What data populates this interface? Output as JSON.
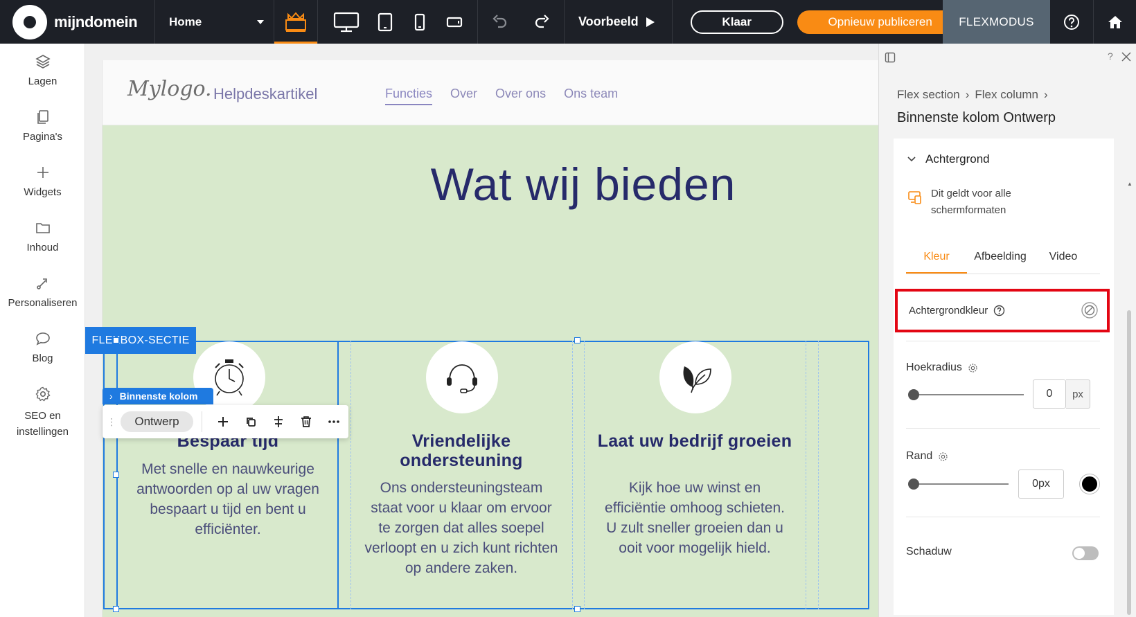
{
  "topbar": {
    "brand": "mijndomein",
    "page_select": "Home",
    "preview": "Voorbeeld",
    "done": "Klaar",
    "publish": "Opnieuw publiceren",
    "flexmode": "FLEXMODUS",
    "accent_color": "#f98b14"
  },
  "sidebar": {
    "items": [
      {
        "label": "Lagen",
        "icon": "layers-icon"
      },
      {
        "label": "Pagina's",
        "icon": "pages-icon"
      },
      {
        "label": "Widgets",
        "icon": "plus-icon"
      },
      {
        "label": "Inhoud",
        "icon": "folder-icon"
      },
      {
        "label": "Personaliseren",
        "icon": "personalize-icon"
      },
      {
        "label": "Blog",
        "icon": "chat-bubble-icon"
      },
      {
        "label": "SEO en instellingen",
        "icon": "gear-icon"
      }
    ]
  },
  "site": {
    "logo": "Mylogo.",
    "title": "Helpdeskartikel",
    "nav": [
      "Functies",
      "Over",
      "Over ons",
      "Ons team"
    ],
    "heading": "Wat wij bieden",
    "flex_tag": "FLEXBOX-SECTIE",
    "inner_tag": "Binnenste kolom",
    "toolbar_pill": "Ontwerp",
    "features": [
      {
        "title": "Bespaar tijd",
        "text": "Met snelle en nauwkeurige antwoorden op al uw vragen bespaart u tijd en bent u efficiënter.",
        "icon": "alarm-clock-icon"
      },
      {
        "title": "Vriendelijke ondersteuning",
        "text": "Ons ondersteuningsteam staat voor u klaar om ervoor te zorgen dat alles soepel verloopt en u zich kunt richten op andere zaken.",
        "icon": "headset-icon"
      },
      {
        "title": "Laat uw bedrijf groeien",
        "text": "Kijk hoe uw winst en efficiëntie omhoog schieten. U zult sneller groeien dan u ooit voor mogelijk hield.",
        "icon": "leaf-icon"
      }
    ]
  },
  "panel": {
    "breadcrumb": [
      "Flex section",
      "Flex column"
    ],
    "title": "Binnenste kolom Ontwerp",
    "section": "Achtergrond",
    "note": "Dit geldt voor alle schermformaten",
    "tabs": [
      "Kleur",
      "Afbeelding",
      "Video"
    ],
    "bg_color_label": "Achtergrondkleur",
    "radius_label": "Hoekradius",
    "radius_value": "0",
    "radius_unit": "px",
    "border_label": "Rand",
    "border_value": "0px",
    "shadow_label": "Schaduw",
    "highlight_color": "#e30613"
  }
}
